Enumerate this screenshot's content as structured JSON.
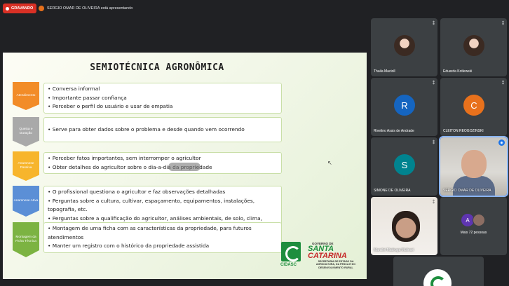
{
  "top_bar": {
    "recording_label": "GRAVANDO",
    "presenter_text": "SERGIO OMAR DE OLIVEIRA está apresentando"
  },
  "slide": {
    "title": "SEMIOTÉCNICA AGRONÔMICA",
    "rows": [
      {
        "stage": "Atendimento",
        "color": "#f28c28",
        "items": [
          "Conversa informal",
          "Importante passar confiança",
          "Perceber o perfil do usuário e usar de empatia"
        ]
      },
      {
        "stage": "Queixa e Duração",
        "color": "#a9a9a9",
        "items": [
          "Serve para obter dados sobre o problema e desde quando vem ocorrendo"
        ]
      },
      {
        "stage": "Anamnese Passiva",
        "color": "#f7b52c",
        "items": [
          "Perceber fatos importantes, sem interromper o agricultor",
          "Obter detalhes do agricultor sobre o dia-a-dia da propriedade"
        ]
      },
      {
        "stage": "Anamnese Ativa",
        "color": "#5b8fd6",
        "items": [
          "O profissional questiona o agricultor e faz observações detalhadas",
          "Perguntas sobre a cultura, cultivar, espaçamento, equipamentos, instalações, topografia, etc.",
          "Perguntas sobre a qualificação do agricultor, análises ambientais, de solo, clima, irrigação, etc."
        ]
      },
      {
        "stage": "Montagem da Ficha Técnica",
        "color": "#7cb342",
        "items": [
          "Montagem de uma ficha com as características da propriedade, para futuros atendimentos",
          "Manter um registro com o histórico da propriedade assistida"
        ]
      }
    ],
    "logos": {
      "cidasc": "CIDASC",
      "gov_line1": "GOVERNO DE",
      "gov_line2": "SANTA",
      "gov_line3": "CATARINA",
      "gov_sub": "SECRETARIA DE ESTADO DA AGRICULTURA, DA PESCA E DO DESENVOLVIMENTO RURAL"
    }
  },
  "participants": [
    {
      "name": "Thaila Macioll",
      "type": "photo"
    },
    {
      "name": "Eduarda Kotlewski",
      "type": "photo"
    },
    {
      "name": "Rivelino Assis de Andrade",
      "initial": "R",
      "color": "#1565c0"
    },
    {
      "name": "CLEITON REOGOZINSKI",
      "initial": "C",
      "color": "#e8711c"
    },
    {
      "name": "SIMONE DE OLIVEIRA",
      "initial": "S",
      "color": "#00838f"
    },
    {
      "name": "SERGIO OMAR DE OLIVEIRA",
      "type": "video"
    },
    {
      "name": "Marcilei Madruga Mulinari",
      "type": "video"
    },
    {
      "name": "Mais 72 pessoas",
      "initial": "A"
    }
  ]
}
